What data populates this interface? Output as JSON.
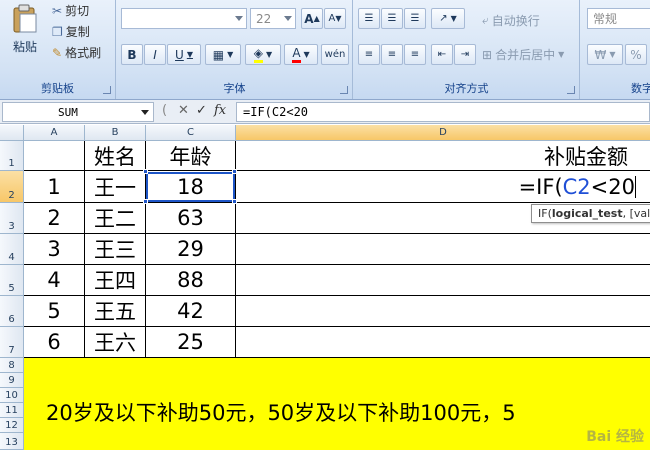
{
  "ribbon": {
    "clipboard": {
      "paste_label": "粘贴",
      "cut_label": "剪切",
      "copy_label": "复制",
      "format_painter_label": "格式刷",
      "group_label": "剪贴板"
    },
    "font": {
      "font_name": "",
      "font_size": "22",
      "bold": "B",
      "italic": "I",
      "underline": "U",
      "group_label": "字体",
      "grow": "A",
      "shrink": "A"
    },
    "alignment": {
      "wrap_text_label": "自动换行",
      "merge_center_label": "合并后居中",
      "group_label": "对齐方式"
    },
    "number": {
      "format_value": "常规",
      "percent": "%",
      "group_label": "数字"
    }
  },
  "formula_bar": {
    "name_box": "SUM",
    "cancel": "✕",
    "enter": "✓",
    "fx": "fx",
    "formula": "=IF(C2<20"
  },
  "sheet": {
    "columns": [
      "A",
      "B",
      "C",
      "D"
    ],
    "rows": [
      "1",
      "2",
      "3",
      "4",
      "5",
      "6",
      "7",
      "8",
      "9",
      "10",
      "11",
      "12",
      "13"
    ],
    "headers": {
      "name": "姓名",
      "age": "年龄",
      "subsidy": "补贴金额"
    },
    "data": [
      {
        "num": "1",
        "name": "王一",
        "age": "18"
      },
      {
        "num": "2",
        "name": "王二",
        "age": "63"
      },
      {
        "num": "3",
        "name": "王三",
        "age": "29"
      },
      {
        "num": "4",
        "name": "王四",
        "age": "88"
      },
      {
        "num": "5",
        "name": "王五",
        "age": "42"
      },
      {
        "num": "6",
        "name": "王六",
        "age": "25"
      }
    ],
    "editing_cell": {
      "prefix": "=IF(",
      "ref": "C2",
      "suffix": "<20"
    },
    "tooltip": {
      "func": "IF(",
      "arg": "logical_test",
      "rest": ", [val"
    },
    "note": "20岁及以下补助50元，50岁及以下补助100元，5"
  },
  "watermark": "Bai 经验",
  "colors": {
    "highlight": "#ffff00",
    "selection": "#1e55c7",
    "ref": "#1f4fd6"
  }
}
